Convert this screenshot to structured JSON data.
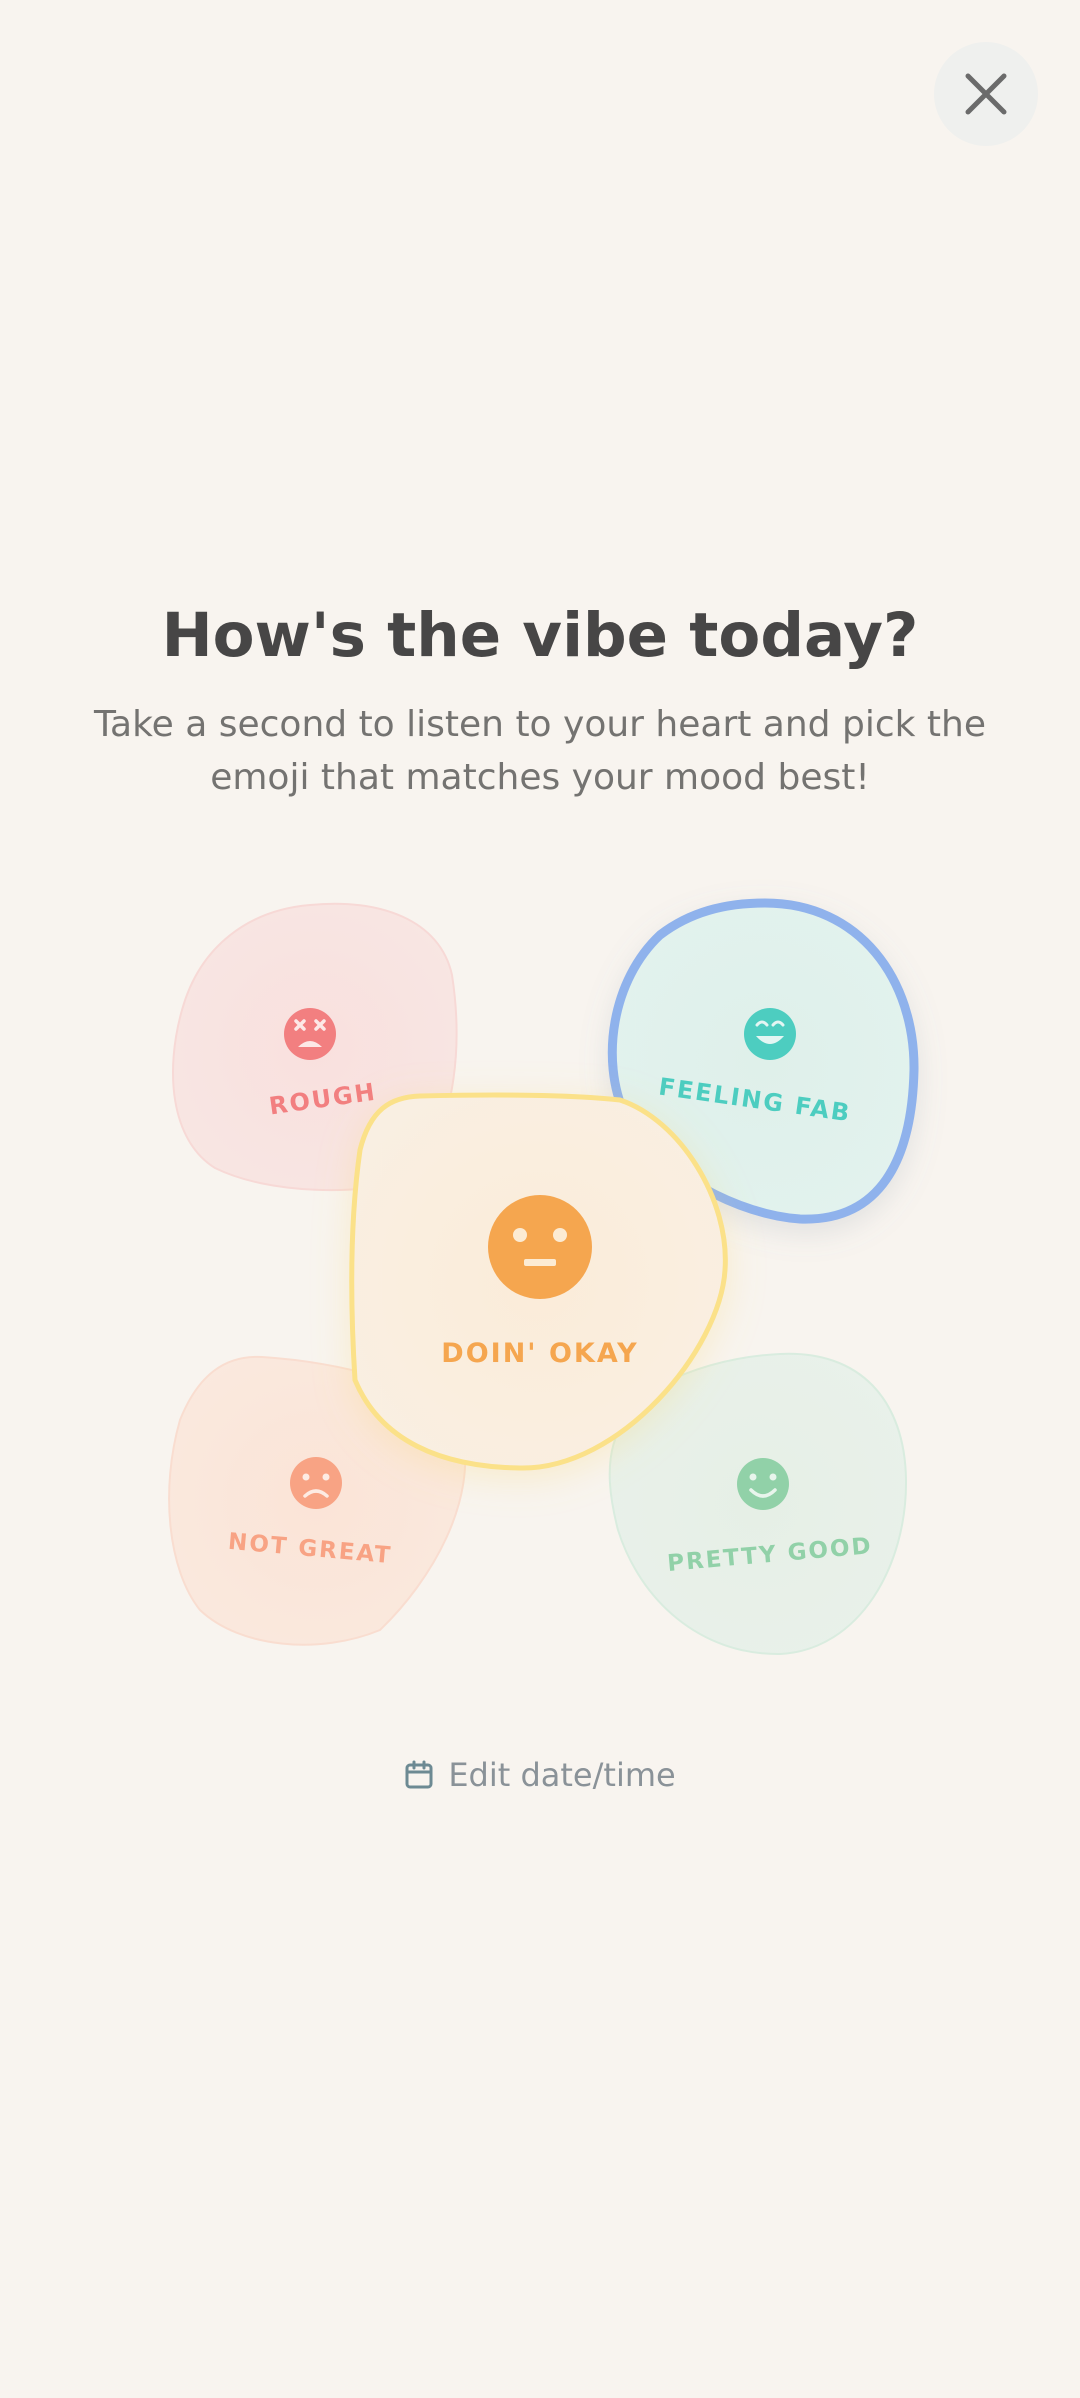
{
  "header": {
    "close_icon": "close-icon"
  },
  "prompt": {
    "title": "How's the vibe today?",
    "subtitle": "Take a second to listen to your heart and pick the emoji that matches your mood best!"
  },
  "moods": {
    "rough": {
      "label": "ROUGH",
      "icon": "dizzy-face-icon",
      "color": "#f27f80",
      "selected": false
    },
    "feeling_fab": {
      "label": "FEELING FAB",
      "icon": "grinning-face-icon",
      "color": "#4dcdc0",
      "selected": true,
      "outline_color": "#8fb2ec"
    },
    "doin_okay": {
      "label": "DOIN' OKAY",
      "icon": "neutral-face-icon",
      "color": "#f5a64f",
      "selected": false,
      "outline_color": "#fbe189"
    },
    "not_great": {
      "label": "NOT GREAT",
      "icon": "sad-face-icon",
      "color": "#f8a384",
      "selected": false
    },
    "pretty_good": {
      "label": "PRETTY GOOD",
      "icon": "smiling-face-icon",
      "color": "#91d1a8",
      "selected": false
    }
  },
  "footer": {
    "edit_label": "Edit date/time",
    "calendar_icon": "calendar-icon"
  }
}
